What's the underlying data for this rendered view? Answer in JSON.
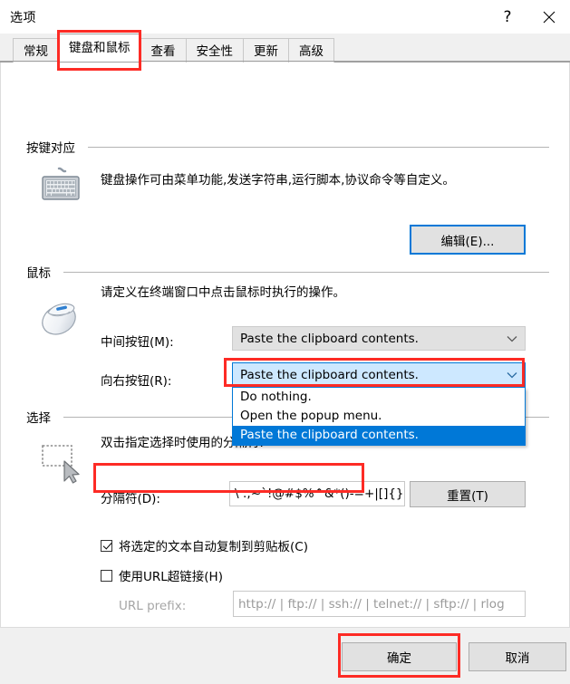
{
  "window": {
    "title": "选项",
    "help_button": "?",
    "close_button": "✕"
  },
  "tabs": [
    {
      "label": "常规",
      "active": false
    },
    {
      "label": "键盘和鼠标",
      "active": true
    },
    {
      "label": "查看",
      "active": false
    },
    {
      "label": "安全性",
      "active": false
    },
    {
      "label": "更新",
      "active": false
    },
    {
      "label": "高级",
      "active": false
    }
  ],
  "keyboard_section": {
    "title": "按键对应",
    "description": "键盘操作可由菜单功能,发送字符串,运行脚本,协议命令等自定义。",
    "icon": "keyboard-icon",
    "edit_button": "编辑(E)..."
  },
  "mouse_section": {
    "title": "鼠标",
    "description": "请定义在终端窗口中点击鼠标时执行的操作。",
    "icon": "mouse-icon",
    "middle_button_label": "中间按钮(M):",
    "middle_button_value": "Paste the clipboard contents.",
    "right_button_label": "向右按钮(R):",
    "right_button_value": "Paste the clipboard contents.",
    "dropdown_options": [
      "Do nothing.",
      "Open the popup menu.",
      "Paste the clipboard contents."
    ],
    "dropdown_selected_index": 2
  },
  "selection_section": {
    "title": "选择",
    "description": "双击指定选择时使用的分隔符.",
    "icon": "selection-cursor-icon",
    "delimiter_label": "分隔符(D):",
    "delimiter_value": "\\ :;~`!@#$%^&*()-=+|[]{}'",
    "reset_button": "重置(T)",
    "auto_copy_label": "将选定的文本自动复制到剪贴板(C)",
    "auto_copy_checked": true,
    "url_hyperlink_label": "使用URL超链接(H)",
    "url_hyperlink_checked": false,
    "url_prefix_label": "URL prefix:",
    "url_prefix_value": "http:// | ftp:// | ssh:// | telnet:// | sftp:// | rlog"
  },
  "footer": {
    "ok_button": "确定",
    "cancel_button": "取消"
  },
  "colors": {
    "accent": "#0078d7",
    "annotation": "#fd2b25",
    "combo_bg": "#e1e1e1",
    "focus_bg": "#cde8ff"
  }
}
